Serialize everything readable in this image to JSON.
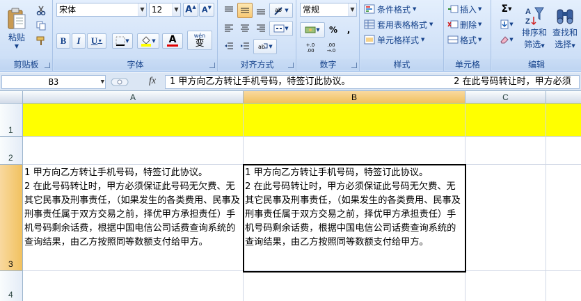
{
  "ribbon": {
    "clipboard": {
      "paste_label": "粘贴",
      "group_label": "剪贴板"
    },
    "font": {
      "font_name": "宋体",
      "font_size": "12",
      "bold": "B",
      "italic": "I",
      "underline": "U",
      "phonetic": "wén",
      "font_color_label": "A",
      "group_label": "字体"
    },
    "alignment": {
      "group_label": "对齐方式"
    },
    "number": {
      "format": "常规",
      "percent": "%",
      "comma": ",",
      "inc_decimal": "+.0 .00",
      "dec_decimal": ".00 →.0",
      "group_label": "数字"
    },
    "styles": {
      "conditional_format": "条件格式",
      "table_format": "套用表格格式",
      "cell_styles": "单元格样式",
      "group_label": "样式"
    },
    "cells": {
      "insert": "插入",
      "delete": "删除",
      "format": "格式",
      "group_label": "单元格"
    },
    "editing": {
      "sort_filter_line1": "排序和",
      "sort_filter_line2": "筛选",
      "find_select_line1": "查找和",
      "find_select_line2": "选择",
      "group_label": "编辑"
    },
    "colors": {
      "highlight": "#ffff00",
      "font_color": "#e00000"
    }
  },
  "formula_bar": {
    "name_box": "B3",
    "fx": "fx",
    "content": "1 甲方向乙方转让手机号码，特签订此协议。                                    2 在此号码转让时，甲方必须"
  },
  "grid": {
    "columns": [
      "A",
      "B",
      "C"
    ],
    "rows": [
      "1",
      "2",
      "3",
      "4"
    ],
    "row1_fill": "#ffff00",
    "cells": {
      "A3": "1 甲方向乙方转让手机号码，特签订此协议。                        2 在此号码转让时，甲方必须保证此号码无欠费、无其它民事及刑事责任，（如果发生的各类费用、民事及刑事责任属于双方交易之前，择优甲方承担责任）手机号码剩余话费，根据中国电信公司话费查询系统的查询结果，由乙方按照同等数额支付给甲方。",
      "B3": "1 甲方向乙方转让手机号码，特签订此协议。            2 在此号码转让时，甲方必须保证此号码无欠费、无其它民事及刑事责任，（如果发生的各类费用、民事及刑事责任属于双方交易之前，择优甲方承担责任）手机号码剩余话费，根据中国电信公司话费查询系统的查询结果，由乙方按照同等数额支付给甲方。"
    },
    "selected_cell": "B3"
  }
}
